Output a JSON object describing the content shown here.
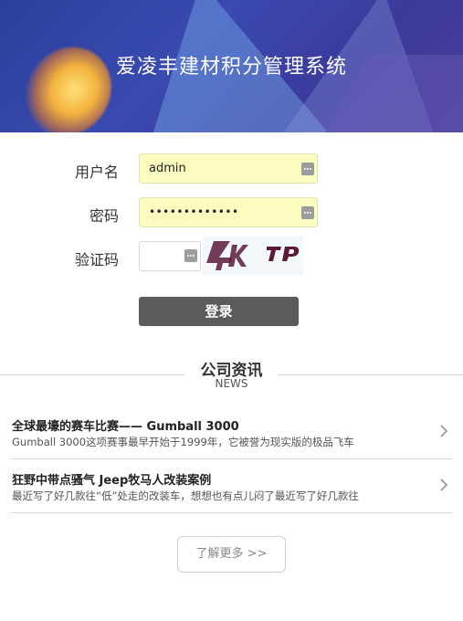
{
  "header": {
    "title": "爱凌丰建材积分管理系统"
  },
  "login_form": {
    "username_label": "用户名",
    "username_value": "admin",
    "password_label": "密码",
    "password_masked": "•••••••••••••",
    "captcha_label": "验证码",
    "captcha_value": "",
    "captcha_image_text": "4K TP",
    "login_button": "登录"
  },
  "news": {
    "title": "公司资讯",
    "subtitle": "NEWS",
    "items": [
      {
        "headline": "全球最壕的赛车比赛—— Gumball 3000",
        "summary": "Gumball 3000这项赛事最早开始于1999年，它被誉为现实版的极品飞车"
      },
      {
        "headline": "狂野中带点骚气 Jeep牧马人改装案例",
        "summary": "最近写了好几款往“低”处走的改装车，想想也有点儿闷了最近写了好几款往"
      }
    ],
    "more_button": "了解更多 >>"
  },
  "colors": {
    "banner": "#2a3f9a",
    "input_autofill": "#fbfdc0",
    "login_button": "#5b5b5b"
  }
}
